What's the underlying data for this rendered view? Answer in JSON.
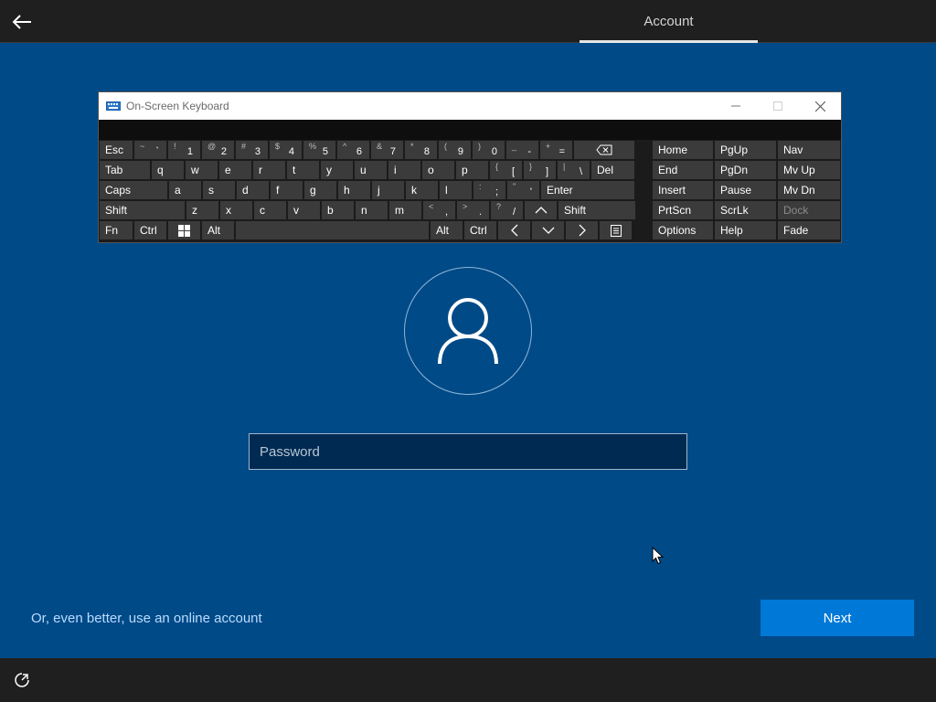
{
  "header": {
    "tab_label": "Account"
  },
  "osk": {
    "title": "On-Screen Keyboard",
    "rows": [
      [
        {
          "w": 38,
          "label": "Esc"
        },
        {
          "w": 37,
          "shift": "~",
          "main": "`"
        },
        {
          "w": 37,
          "shift": "!",
          "main": "1"
        },
        {
          "w": 37,
          "shift": "@",
          "main": "2"
        },
        {
          "w": 37,
          "shift": "#",
          "main": "3"
        },
        {
          "w": 37,
          "shift": "$",
          "main": "4"
        },
        {
          "w": 37,
          "shift": "%",
          "main": "5"
        },
        {
          "w": 37,
          "shift": "^",
          "main": "6"
        },
        {
          "w": 37,
          "shift": "&",
          "main": "7"
        },
        {
          "w": 37,
          "shift": "*",
          "main": "8"
        },
        {
          "w": 37,
          "shift": "(",
          "main": "9"
        },
        {
          "w": 37,
          "shift": ")",
          "main": "0"
        },
        {
          "w": 37,
          "shift": "_",
          "main": "-"
        },
        {
          "w": 37,
          "shift": "+",
          "main": "="
        },
        {
          "w": 68,
          "icon": "backspace-icon"
        }
      ],
      [
        {
          "w": 57,
          "label": "Tab"
        },
        {
          "w": 37,
          "label": "q"
        },
        {
          "w": 37,
          "label": "w"
        },
        {
          "w": 37,
          "label": "e"
        },
        {
          "w": 37,
          "label": "r"
        },
        {
          "w": 37,
          "label": "t"
        },
        {
          "w": 37,
          "label": "y"
        },
        {
          "w": 37,
          "label": "u"
        },
        {
          "w": 37,
          "label": "i"
        },
        {
          "w": 37,
          "label": "o"
        },
        {
          "w": 37,
          "label": "p"
        },
        {
          "w": 37,
          "shift": "{",
          "main": "["
        },
        {
          "w": 37,
          "shift": "}",
          "main": "]"
        },
        {
          "w": 37,
          "shift": "|",
          "main": "\\"
        },
        {
          "w": 49,
          "label": "Del"
        }
      ],
      [
        {
          "w": 76,
          "label": "Caps"
        },
        {
          "w": 37,
          "label": "a"
        },
        {
          "w": 37,
          "label": "s"
        },
        {
          "w": 37,
          "label": "d"
        },
        {
          "w": 37,
          "label": "f"
        },
        {
          "w": 37,
          "label": "g"
        },
        {
          "w": 37,
          "label": "h"
        },
        {
          "w": 37,
          "label": "j"
        },
        {
          "w": 37,
          "label": "k"
        },
        {
          "w": 37,
          "label": "l"
        },
        {
          "w": 37,
          "shift": ":",
          "main": ";"
        },
        {
          "w": 37,
          "shift": "\"",
          "main": "'"
        },
        {
          "w": 104,
          "label": "Enter"
        }
      ],
      [
        {
          "w": 95,
          "label": "Shift"
        },
        {
          "w": 37,
          "label": "z"
        },
        {
          "w": 37,
          "label": "x"
        },
        {
          "w": 37,
          "label": "c"
        },
        {
          "w": 37,
          "label": "v"
        },
        {
          "w": 37,
          "label": "b"
        },
        {
          "w": 37,
          "label": "n"
        },
        {
          "w": 37,
          "label": "m"
        },
        {
          "w": 37,
          "shift": "<",
          "main": ","
        },
        {
          "w": 37,
          "shift": ">",
          "main": "."
        },
        {
          "w": 37,
          "shift": "?",
          "main": "/"
        },
        {
          "w": 37,
          "icon": "arrow-up-icon"
        },
        {
          "w": 86,
          "label": "Shift"
        }
      ],
      [
        {
          "w": 38,
          "label": "Fn"
        },
        {
          "w": 37,
          "label": "Ctrl"
        },
        {
          "w": 37,
          "icon": "windows-icon"
        },
        {
          "w": 37,
          "label": "Alt"
        },
        {
          "w": 213,
          "label": ""
        },
        {
          "w": 37,
          "label": "Alt"
        },
        {
          "w": 37,
          "label": "Ctrl"
        },
        {
          "w": 37,
          "icon": "arrow-left-icon"
        },
        {
          "w": 37,
          "icon": "arrow-down-icon"
        },
        {
          "w": 37,
          "icon": "arrow-right-icon"
        },
        {
          "w": 37,
          "icon": "menu-icon"
        }
      ]
    ],
    "nav_rows": [
      [
        "Home",
        "PgUp",
        "Nav"
      ],
      [
        "End",
        "PgDn",
        "Mv Up"
      ],
      [
        "Insert",
        "Pause",
        "Mv Dn"
      ],
      [
        "PrtScn",
        "ScrLk",
        "Dock"
      ],
      [
        "Options",
        "Help",
        "Fade"
      ]
    ]
  },
  "password": {
    "placeholder": "Password"
  },
  "footer": {
    "online_link": "Or, even better, use an online account",
    "next_label": "Next"
  }
}
